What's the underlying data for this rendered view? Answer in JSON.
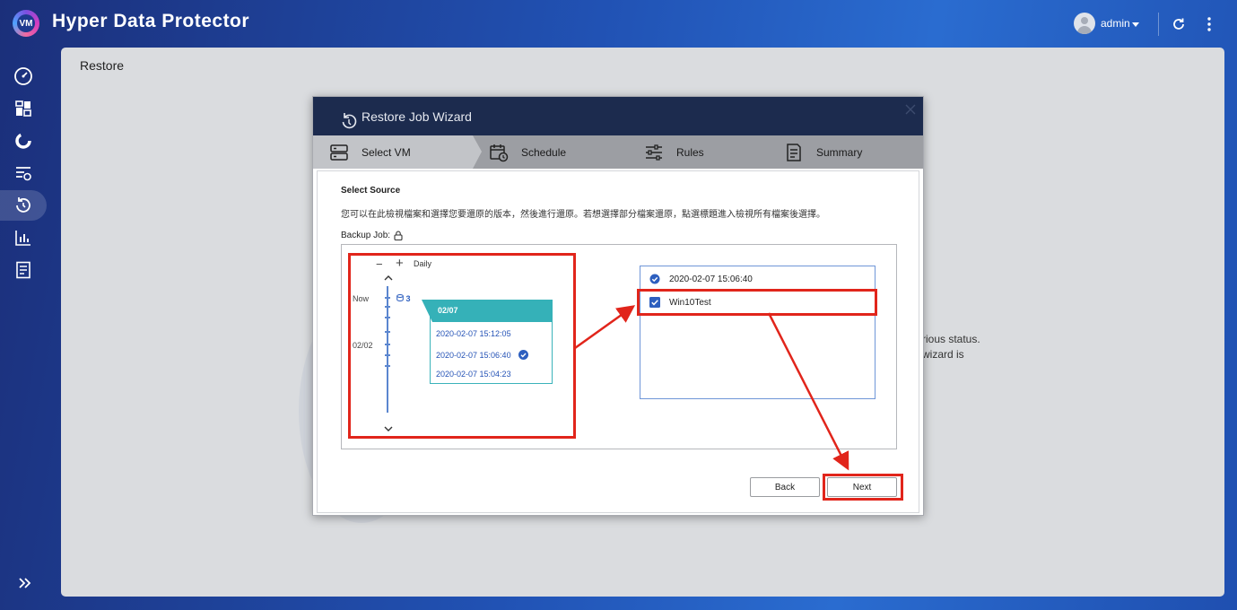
{
  "app": {
    "title": "Hyper Data Protector",
    "logo_text": "VM"
  },
  "user": {
    "name": "admin"
  },
  "sidebar": {
    "items": [
      {
        "name": "dashboard",
        "icon": "gauge-icon",
        "active": false
      },
      {
        "name": "overview",
        "icon": "grid-icon",
        "active": false
      },
      {
        "name": "backup",
        "icon": "backup-ring-icon",
        "active": false
      },
      {
        "name": "jobs",
        "icon": "job-list-icon",
        "active": false
      },
      {
        "name": "restore",
        "icon": "restore-icon",
        "active": true
      },
      {
        "name": "reports",
        "icon": "bar-chart-icon",
        "active": false
      },
      {
        "name": "logs",
        "icon": "log-document-icon",
        "active": false
      }
    ]
  },
  "page": {
    "title": "Restore",
    "background_text": [
      "rious status.",
      "wizard is"
    ]
  },
  "wizard": {
    "title": "Restore Job Wizard",
    "steps": [
      {
        "label": "Select VM",
        "icon": "server-icon",
        "active": true
      },
      {
        "label": "Schedule",
        "icon": "calendar-clock-icon",
        "active": false
      },
      {
        "label": "Rules",
        "icon": "sliders-icon",
        "active": false
      },
      {
        "label": "Summary",
        "icon": "summary-doc-icon",
        "active": false
      }
    ],
    "section_title": "Select Source",
    "instruction": "您可以在此檢視檔案和選擇您要還原的版本，然後進行還原。若想選擇部分檔案還原，點選標題進入檢視所有檔案後選擇。",
    "backup_job_label": "Backup Job:",
    "timeline": {
      "zoom_minus": "−",
      "zoom_plus": "+",
      "granularity": "Daily",
      "labels": [
        "Now",
        "02/02"
      ],
      "version_count": "3",
      "popup_date": "02/07",
      "versions": [
        "2020-02-07 15:12:05",
        "2020-02-07 15:06:40",
        "2020-02-07 15:04:23"
      ],
      "selected_version": 1
    },
    "selection": {
      "version": "2020-02-07 15:06:40",
      "vm_name": "Win10Test"
    },
    "buttons": {
      "back": "Back",
      "next": "Next"
    }
  },
  "colors": {
    "accent": "#2d5fbf",
    "teal": "#35b1b8",
    "annotation": "#e1251b",
    "header": "#1c2b4e"
  }
}
